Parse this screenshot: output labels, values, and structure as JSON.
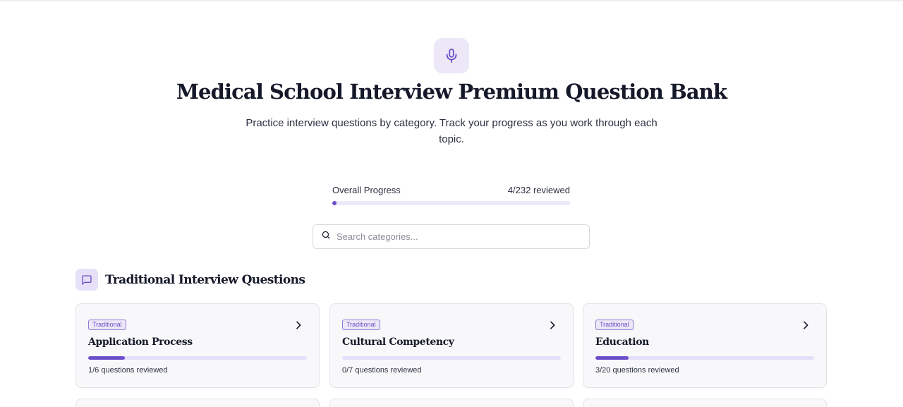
{
  "header": {
    "title": "Medical School Interview Premium Question Bank",
    "subtitle": "Practice interview questions by category. Track your progress as you work through each topic.",
    "icon": "microphone-icon"
  },
  "progress": {
    "label": "Overall Progress",
    "status": "4/232 reviewed",
    "reviewed": 4,
    "total": 232
  },
  "search": {
    "placeholder": "Search categories..."
  },
  "section": {
    "title": "Traditional Interview Questions",
    "icon": "chat-bubble-icon"
  },
  "categories": [
    {
      "badge": "Traditional",
      "title": "Application Process",
      "status": "1/6 questions reviewed",
      "reviewed": 1,
      "total": 6
    },
    {
      "badge": "Traditional",
      "title": "Cultural Competency",
      "status": "0/7 questions reviewed",
      "reviewed": 0,
      "total": 7
    },
    {
      "badge": "Traditional",
      "title": "Education",
      "status": "3/20 questions reviewed",
      "reviewed": 3,
      "total": 20
    }
  ],
  "colors": {
    "accent": "#6b4fc8",
    "accent_light": "#ece8f7",
    "track": "#e4dffa",
    "heading": "#15192a"
  }
}
